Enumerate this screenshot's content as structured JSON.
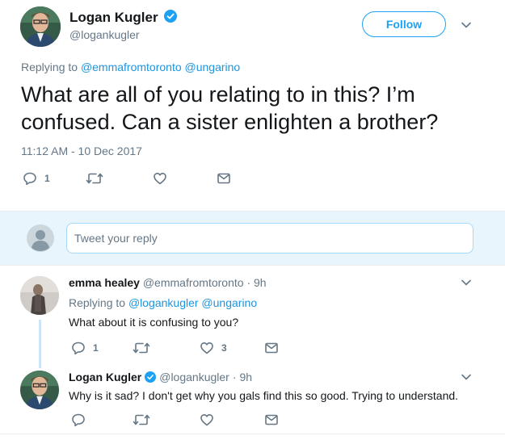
{
  "main_tweet": {
    "author_name": "Logan Kugler",
    "handle": "@logankugler",
    "follow_label": "Follow",
    "replying_prefix": "Replying to",
    "replying_to": "@emmafromtoronto @ungarino",
    "text": "What are all of you relating to in this? I’m confused. Can a sister enlighten a brother?",
    "timestamp": "11:12 AM - 10 Dec 2017",
    "reply_count": "1"
  },
  "reply_box": {
    "placeholder": "Tweet your reply"
  },
  "replies": [
    {
      "author_name": "emma healey",
      "handle": "@emmafromtoronto",
      "separator": "·",
      "time": "9h",
      "replying_prefix": "Replying to",
      "replying_to": "@logankugler @ungarino",
      "text": "What about it is confusing to you?",
      "reply_count": "1",
      "like_count": "3"
    },
    {
      "author_name": "Logan Kugler",
      "handle": "@logankugler",
      "separator": "·",
      "time": "9h",
      "text": "Why is it sad? I don't get why you gals find this so good. Trying to understand."
    }
  ],
  "colors": {
    "accent": "#1da1f2",
    "link": "#1b95e0",
    "muted": "#657786",
    "reply_bar_bg": "#e8f5fd"
  },
  "icons": [
    "verified-icon",
    "chevron-down-icon",
    "reply-icon",
    "retweet-icon",
    "like-icon",
    "message-icon",
    "default-avatar-icon"
  ]
}
